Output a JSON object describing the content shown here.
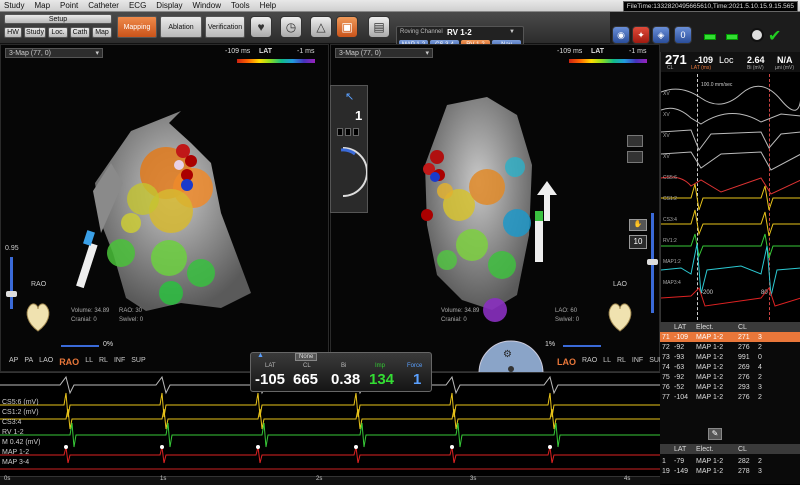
{
  "menu": [
    "Study",
    "Map",
    "Point",
    "Catheter",
    "ECG",
    "Display",
    "Window",
    "Tools",
    "Help"
  ],
  "filetime": "FileTime:1332820495665610,Time:2021.5.10.15.9.15.565",
  "toolbar": {
    "setup_label": "Setup",
    "sub_tabs": [
      "HW",
      "Study",
      "Loc.",
      "Cath",
      "Map"
    ],
    "mapping": "Mapping",
    "ablation": "Ablation",
    "verification": "Verification",
    "roving_channel_label": "Roving Channel",
    "roving_channel_value": "RV 1-2",
    "channel_buttons": [
      "MAP 1-2",
      "CS 3-4",
      "RV 1-2",
      "Nav"
    ]
  },
  "left_map": {
    "header": "3-Map (77, 0)",
    "lat_label": "LAT",
    "lat_min": "-109 ms",
    "lat_max": "-1 ms",
    "scale_value": "0.95",
    "volume": "Volume: 34.89",
    "proj_label": "RAO:",
    "proj_value": "30",
    "cranial_label": "Cranial:",
    "cranial_value": "0",
    "swivel_label": "Swivel:",
    "swivel_value": "0",
    "orient_label": "RAO",
    "opacity": "0%",
    "view_buttons": [
      "AP",
      "PA",
      "LAO",
      "RAO",
      "LL",
      "RL",
      "INF",
      "SUP"
    ]
  },
  "right_map": {
    "header": "3-Map (77, 0)",
    "lat_label": "LAT",
    "lat_min": "-109 ms",
    "lat_max": "-1 ms",
    "volume": "Volume: 34.89",
    "proj_label": "LAO:",
    "proj_value": "60",
    "cranial_label": "Cranial:",
    "cranial_value": "0",
    "swivel_label": "Swivel:",
    "swivel_value": "0",
    "orient_label": "LAO",
    "opacity": "1%",
    "zoom_value": "10",
    "view_buttons": [
      "LAO",
      "RAO",
      "LL",
      "RL",
      "INF",
      "SUP"
    ]
  },
  "center_ctl": {
    "value": "1"
  },
  "header_right": {
    "cl_value": "271",
    "cl_label": "CL",
    "lat_value": "-109",
    "lat_label": "LAT (ms)",
    "loc_label": "Loc",
    "bi_value": "2.64",
    "bi_label": "Bi (mV)",
    "uni_value": "N/A",
    "uni_label": "µni (mV)"
  },
  "signals": {
    "marker": "100.0 mm/sec",
    "labels": [
      "XV",
      "XV",
      "XV",
      "XV",
      "CS5:6",
      "CS1:2",
      "CS3:4",
      "RV1:2",
      "MAP1:2",
      "MAP3:4"
    ],
    "tick_left": "-200",
    "tick_right": "80"
  },
  "table": {
    "headers": [
      "",
      "LAT",
      "Elect.",
      "CL",
      ""
    ],
    "rows": [
      [
        "71",
        "-109",
        "MAP 1-2",
        "271",
        "3"
      ],
      [
        "72",
        "-92",
        "MAP 1-2",
        "276",
        "2"
      ],
      [
        "73",
        "-93",
        "MAP 1-2",
        "991",
        "0"
      ],
      [
        "74",
        "-63",
        "MAP 1-2",
        "269",
        "4"
      ],
      [
        "75",
        "-92",
        "MAP 1-2",
        "276",
        "2"
      ],
      [
        "76",
        "-52",
        "MAP 1-2",
        "293",
        "3"
      ],
      [
        "77",
        "-104",
        "MAP 1-2",
        "276",
        "2"
      ]
    ],
    "lower_headers": [
      "",
      "LAT",
      "Elect.",
      "CL",
      ""
    ],
    "lower_rows": [
      [
        "1",
        "-79",
        "MAP 1-2",
        "282",
        "2"
      ],
      [
        "19",
        "-149",
        "MAP 1-2",
        "278",
        "3"
      ]
    ]
  },
  "readout": {
    "none_label": "None",
    "lat_label": "LAT",
    "lat": "-105",
    "cl_label": "CL",
    "cl": "665",
    "bi_label": "Bi",
    "bi": "0.38",
    "imp_label": "Imp",
    "imp": "134",
    "force_label": "Force",
    "force": "1"
  },
  "strip": {
    "channel_labels": [
      "CS5:6 (mV)",
      "CS1:2 (mV)",
      "CS3:4",
      "RV 1-2",
      "M 0.42 (mV)",
      "MAP 1-2",
      "MAP 3-4"
    ],
    "time_ticks": [
      "0s",
      "1s",
      "2s",
      "3s",
      "4s"
    ]
  },
  "colors": {
    "accent": "#e9773a",
    "lat_green": "#46d446",
    "signal_yellow": "#e8c31a",
    "signal_green": "#37c837",
    "signal_red": "#d22",
    "signal_cyan": "#2cc9d2"
  }
}
